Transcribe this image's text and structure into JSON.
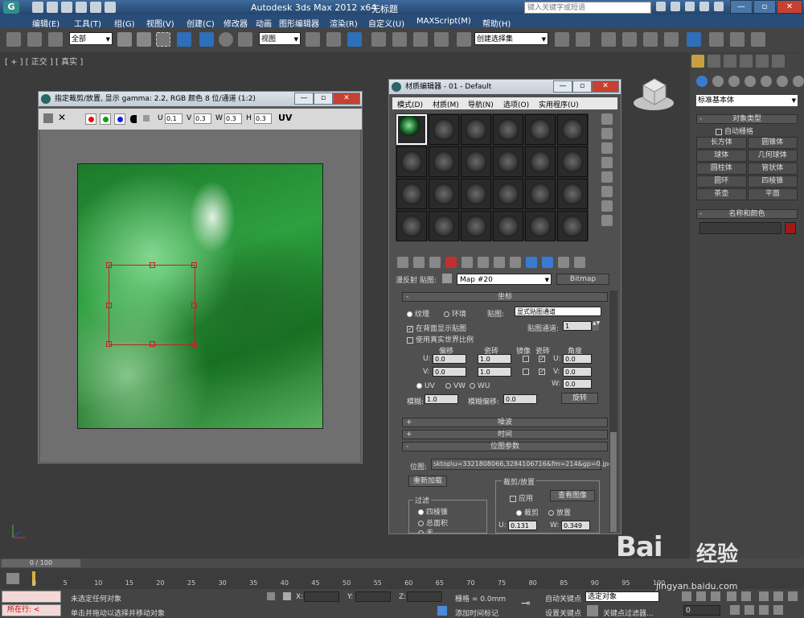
{
  "title_bar": {
    "app_title": "Autodesk 3ds Max  2012 x64",
    "doc_title": "无标题",
    "search_placeholder": "键入关键字或短语"
  },
  "menu": [
    "编辑(E)",
    "工具(T)",
    "组(G)",
    "视图(V)",
    "创建(C)",
    "修改器",
    "动画",
    "图形编辑器",
    "渲染(R)",
    "自定义(U)",
    "MAXScript(M)",
    "帮助(H)"
  ],
  "toolbar": {
    "filter": "全部",
    "ref_coord": "视图",
    "selection_set": "创建选择集"
  },
  "viewport": {
    "label": "[ + ] [ 正交 ] [ 真实 ]"
  },
  "vfb": {
    "title": "指定裁剪/放置, 显示 gamma: 2.2, RGB 颜色 8 位/通道 (1:2)",
    "u_label": "U",
    "u_val": "0.1",
    "v_label": "V",
    "v_val": "0.3",
    "w_label": "W",
    "w_val": "0.3",
    "h_label": "H",
    "h_val": "0.3",
    "uv_label": "UV",
    "channel_colors": [
      "#e01010",
      "#10a010",
      "#1020e0"
    ]
  },
  "command_panel": {
    "category": "标准基本体",
    "object_type_header": "对象类型",
    "autogrid": "自动栅格",
    "objects": [
      "长方体",
      "圆锥体",
      "球体",
      "几何球体",
      "圆柱体",
      "管状体",
      "圆环",
      "四棱锥",
      "茶壶",
      "平面"
    ],
    "name_color_header": "名称和颜色"
  },
  "mat_editor": {
    "title": "材质编辑器 - 01 - Default",
    "menus": [
      "模式(D)",
      "材质(M)",
      "导航(N)",
      "选项(O)",
      "实用程序(U)"
    ],
    "map_label": "漫反射 贴图:",
    "map_name": "Map #20",
    "map_type": "Bitmap",
    "coords": {
      "header": "坐标",
      "texture": "纹理",
      "environ": "环境",
      "mapping_label": "贴图:",
      "mapping": "显式贴图通道",
      "show_back": "在背面显示贴图",
      "map_channel_label": "贴图通道:",
      "map_channel": "1",
      "real_world": "使用真实世界比例",
      "offset": "偏移",
      "tiling": "瓷砖",
      "mirror": "镜像",
      "tile": "瓷砖",
      "angle": "角度",
      "u_lbl": "U:",
      "v_lbl": "V:",
      "w_lbl": "W:",
      "u_offset": "0.0",
      "v_offset": "0.0",
      "u_tiling": "1.0",
      "v_tiling": "1.0",
      "u_angle": "0.0",
      "v_angle": "0.0",
      "w_angle": "0.0",
      "uv": "UV",
      "vw": "VW",
      "wu": "WU",
      "blur_label": "模糊:",
      "blur": "1.0",
      "blur_offset_label": "模糊偏移:",
      "blur_offset": "0.0",
      "rotate": "旋转"
    },
    "noise": "噪波",
    "time": "时间",
    "bitmap_params": {
      "header": "位图参数",
      "path_label": "位图:",
      "path": "sktop\\u=3321808066,3284106716&fm=214&gp=0.jpg",
      "reload": "重新加载",
      "crop_group": "裁剪/放置",
      "apply": "应用",
      "view_image": "查看图像",
      "crop": "裁剪",
      "place": "放置",
      "u_lbl": "U:",
      "u_val": "0.131",
      "w_lbl": "W:",
      "w_val": "0.349",
      "filter_group": "过滤",
      "filter_pyramidal": "四棱锥",
      "filter_sat": "总面积",
      "filter_none": "无"
    }
  },
  "timeline": {
    "frame": "0 / 100",
    "ticks": [
      "0",
      "5",
      "10",
      "15",
      "20",
      "25",
      "30",
      "35",
      "40",
      "45",
      "50",
      "55",
      "60",
      "65",
      "70",
      "75",
      "80",
      "85",
      "90",
      "95",
      "100"
    ]
  },
  "status": {
    "listener": "所在行: <",
    "msg1": "未选定任何对象",
    "msg2": "单击并拖动以选择并移动对象",
    "x_label": "X:",
    "y_label": "Y:",
    "z_label": "Z:",
    "grid": "栅格 = 0.0mm",
    "add_time_tag": "添加时间标记",
    "auto_key": "自动关键点",
    "selected": "选定对象",
    "set_key": "设置关键点",
    "key_filters": "关键点过滤器...",
    "frame_val": "0"
  },
  "watermark": {
    "logo": "Bai",
    "logo2": "经验",
    "url": "jingyan.baidu.com"
  }
}
